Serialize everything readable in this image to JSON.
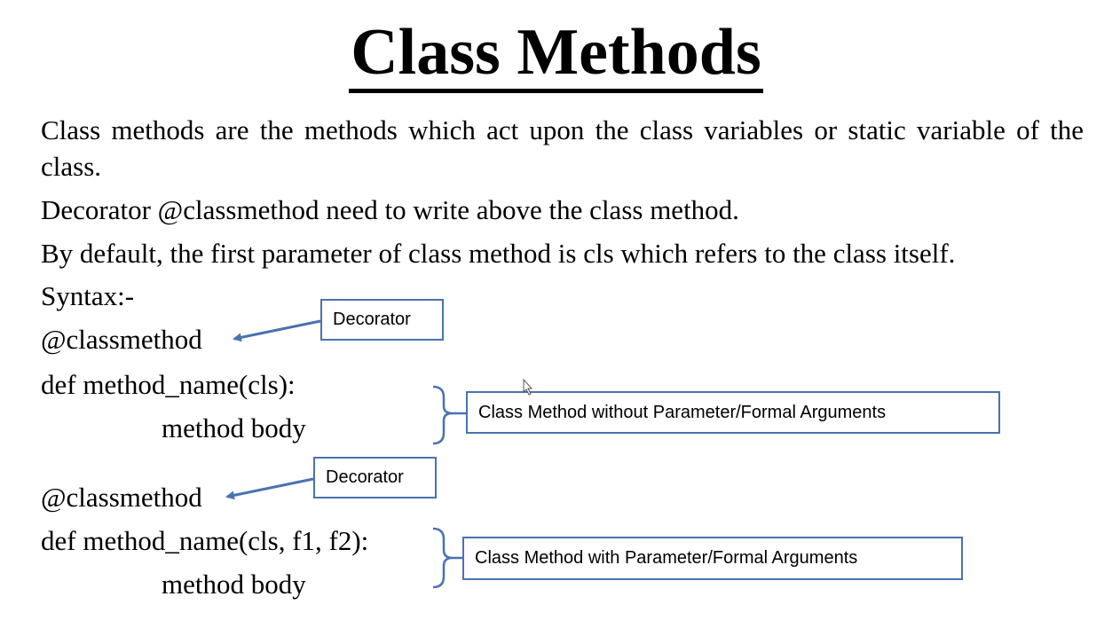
{
  "slide": {
    "title": "Class Methods",
    "paragraphs": [
      "Class methods are the methods which act upon the class variables or static variable of the class.",
      "Decorator @classmethod need to write above the class method.",
      "By default, the first parameter of class method is cls which refers to the class itself."
    ],
    "syntax_label": "Syntax:-",
    "example1": {
      "decorator": "@classmethod",
      "signature": "def method_name(cls):",
      "body": "method body"
    },
    "example2": {
      "decorator": "@classmethod",
      "signature": "def method_name(cls, f1, f2):",
      "body": "method body"
    },
    "callouts": {
      "decorator_1": "Decorator",
      "without_params": "Class Method without Parameter/Formal Arguments",
      "decorator_2": "Decorator",
      "with_params": "Class Method with Parameter/Formal Arguments"
    }
  },
  "colors": {
    "callout_border": "#4a72b0",
    "text": "#000000"
  }
}
